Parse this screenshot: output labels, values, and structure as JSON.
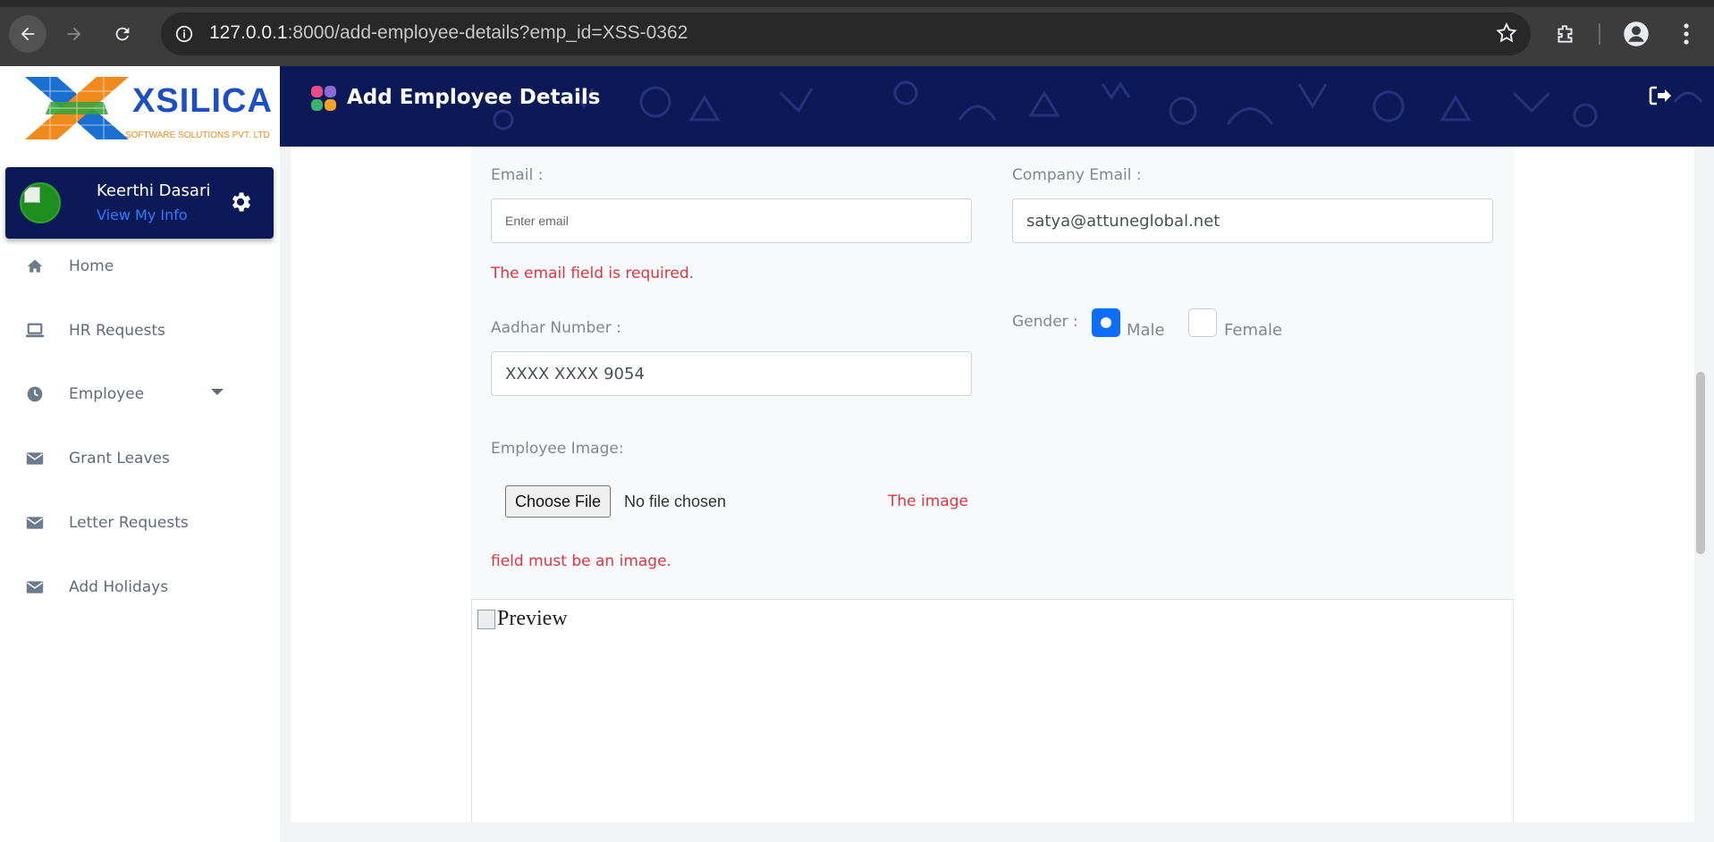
{
  "browser": {
    "url_host": "127.0.0.1",
    "url_rest": ":8000/add-employee-details?emp_id=XSS-0362"
  },
  "sidebar": {
    "logo_text": "XSILICA",
    "logo_tagline": "SOFTWARE SOLUTIONS PVT. LTD",
    "user": {
      "name": "Keerthi Dasari",
      "link": "View My Info"
    },
    "items": [
      {
        "label": "Home",
        "icon": "home-icon"
      },
      {
        "label": "HR Requests",
        "icon": "laptop-icon"
      },
      {
        "label": "Employee",
        "icon": "clock-icon"
      },
      {
        "label": "Grant Leaves",
        "icon": "envelope-icon"
      },
      {
        "label": "Letter Requests",
        "icon": "envelope-icon"
      },
      {
        "label": "Add Holidays",
        "icon": "envelope-icon"
      }
    ]
  },
  "header": {
    "title": "Add Employee Details"
  },
  "form": {
    "email_label": "Email :",
    "email_placeholder": "Enter email",
    "email_error": "The email field is required.",
    "company_email_label": "Company Email :",
    "company_email_value": "satya@attuneglobal.net",
    "aadhar_label": "Aadhar Number :",
    "aadhar_value": "XXXX XXXX 9054",
    "gender_label": "Gender :",
    "gender_options": [
      "Male",
      "Female"
    ],
    "gender_selected": "Male",
    "image_label": "Employee Image:",
    "choose_file": "Choose File",
    "file_status": "No file chosen",
    "image_error_part1": "The image",
    "image_error_part2": "field must be an image.",
    "preview_alt": "Preview"
  },
  "colors": {
    "navy": "#0b1a57",
    "error": "#dc3545",
    "primary": "#0d6efd",
    "link": "#2f7bff"
  }
}
